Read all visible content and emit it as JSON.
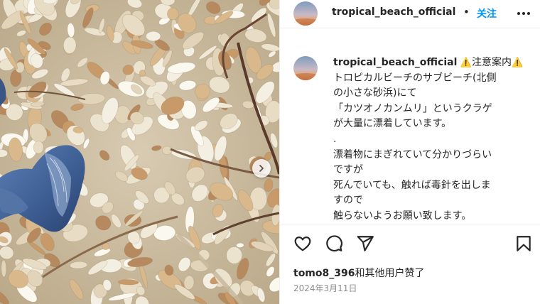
{
  "post": {
    "username": "tropical_beach_official",
    "separator": "•",
    "follow_label": "关注",
    "more_icon": "more-horizontal-icon",
    "caption": {
      "username": "tropical_beach_official",
      "warning_icon": "⚠️",
      "title": "注意案内",
      "lines": [
        "トロピカルビーチのサブビーチ(北側",
        "の小さな砂浜)にて",
        "「カツオノカンムリ」というクラゲ",
        "が大量に漂着しています。",
        ".",
        "漂着物にまぎれていて分かりづらい",
        "ですが",
        "死んでいても、触れば毒針を出しま",
        "すので",
        "触らないようお願い致します。"
      ]
    },
    "actions": {
      "like_icon": "heart-icon",
      "comment_icon": "comment-icon",
      "share_icon": "send-icon",
      "save_icon": "bookmark-icon"
    },
    "likes": {
      "liker": "tomo8_396",
      "suffix": "和其他用户赞了"
    },
    "date": "2024年3月11日",
    "media": {
      "next_icon": "chevron-right-icon"
    }
  },
  "colors": {
    "accent": "#0095f6",
    "text": "#262626",
    "muted": "#8e8e8e",
    "jellyfish": "#3e5f94"
  }
}
